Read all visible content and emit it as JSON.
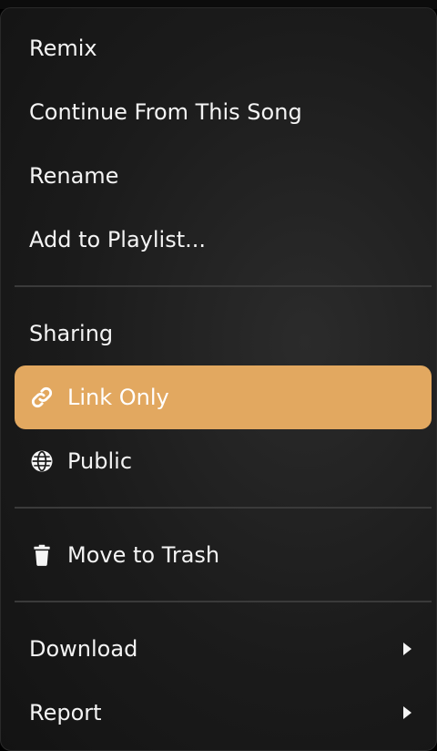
{
  "menu": {
    "items_top": [
      {
        "label": "Remix"
      },
      {
        "label": "Continue From This Song"
      },
      {
        "label": "Rename"
      },
      {
        "label": "Add to Playlist..."
      }
    ],
    "sharing": {
      "header": "Sharing",
      "options": [
        {
          "label": "Link Only",
          "icon": "link-icon",
          "selected": true
        },
        {
          "label": "Public",
          "icon": "globe-icon",
          "selected": false
        }
      ]
    },
    "trash": {
      "label": "Move to Trash",
      "icon": "trash-icon"
    },
    "submenus": [
      {
        "label": "Download",
        "icon": "chevron-right-icon"
      },
      {
        "label": "Report",
        "icon": "chevron-right-icon"
      }
    ]
  },
  "colors": {
    "selected_background": "#e2a860",
    "menu_background": "#1b1b1b",
    "text": "#f4f4f4"
  }
}
